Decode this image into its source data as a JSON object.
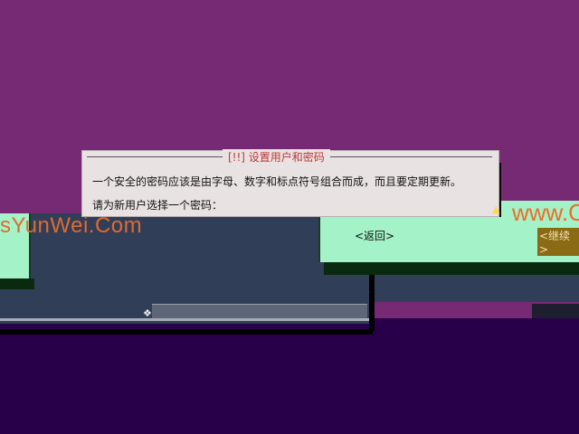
{
  "dialog": {
    "title": "[!!] 设置用户和密码",
    "line1": "一个安全的密码应该是由字母、数字和标点符号组合而成，而且要定期更新。",
    "line2": "请为新用户选择一个密码："
  },
  "buttons": {
    "back_label": "<返回>",
    "continue_label": "<继续>"
  },
  "watermark": {
    "left_text": "sYunWei.Com",
    "right_text": "www.O"
  },
  "colors": {
    "purple_bg": "#772a74",
    "dark_purple": "#28004a",
    "slate": "#313e58",
    "green_panel": "#a4f2c8",
    "dialog_bg": "#e8e2e2",
    "title_red": "#c03838",
    "continue_btn_bg": "#8a6a14"
  }
}
